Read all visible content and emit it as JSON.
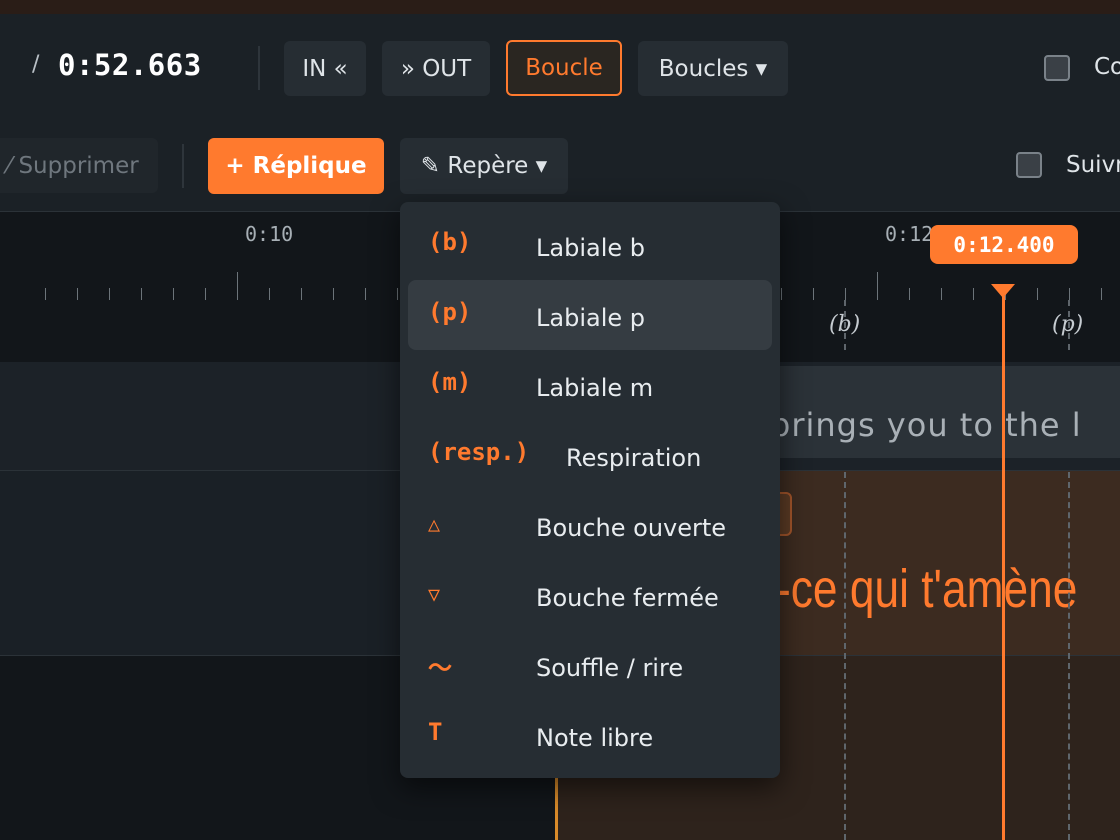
{
  "toolbar": {
    "time_separator": "/",
    "duration": "0:52.663",
    "in_label": "IN «",
    "out_label": "» OUT",
    "loop_label": "Boucle",
    "loops_menu_label": "Boucles ▾",
    "checkbox_label_partial": "Co"
  },
  "edit_toolbar": {
    "delete_label": "⁄ Supprimer",
    "add_line_label": "+ Réplique",
    "marker_menu_label": "✎ Repère ▾",
    "follow_label_partial": "Suivr"
  },
  "ruler": {
    "labels": [
      "0:10",
      "0:12"
    ],
    "playhead_time": "0:12.400"
  },
  "markers": [
    "(b)",
    "(p)"
  ],
  "tracks": {
    "original_text": "brings you to the l",
    "dub_text": "-ce qui t'amène"
  },
  "marker_menu": {
    "items": [
      {
        "symbol": "(b)",
        "label": "Labiale b"
      },
      {
        "symbol": "(p)",
        "label": "Labiale p"
      },
      {
        "symbol": "(m)",
        "label": "Labiale m"
      },
      {
        "symbol": "(resp.)",
        "label": "Respiration"
      },
      {
        "symbol": "△",
        "label": "Bouche ouverte"
      },
      {
        "symbol": "▽",
        "label": "Bouche fermée"
      },
      {
        "symbol": "〜",
        "label": "Souffle / rire"
      },
      {
        "symbol": "T",
        "label": "Note libre"
      }
    ],
    "highlighted_index": 1
  },
  "colors": {
    "accent": "#ff7a2e",
    "background": "#12161a",
    "toolbar": "#1b2126",
    "menu": "#262d33"
  }
}
